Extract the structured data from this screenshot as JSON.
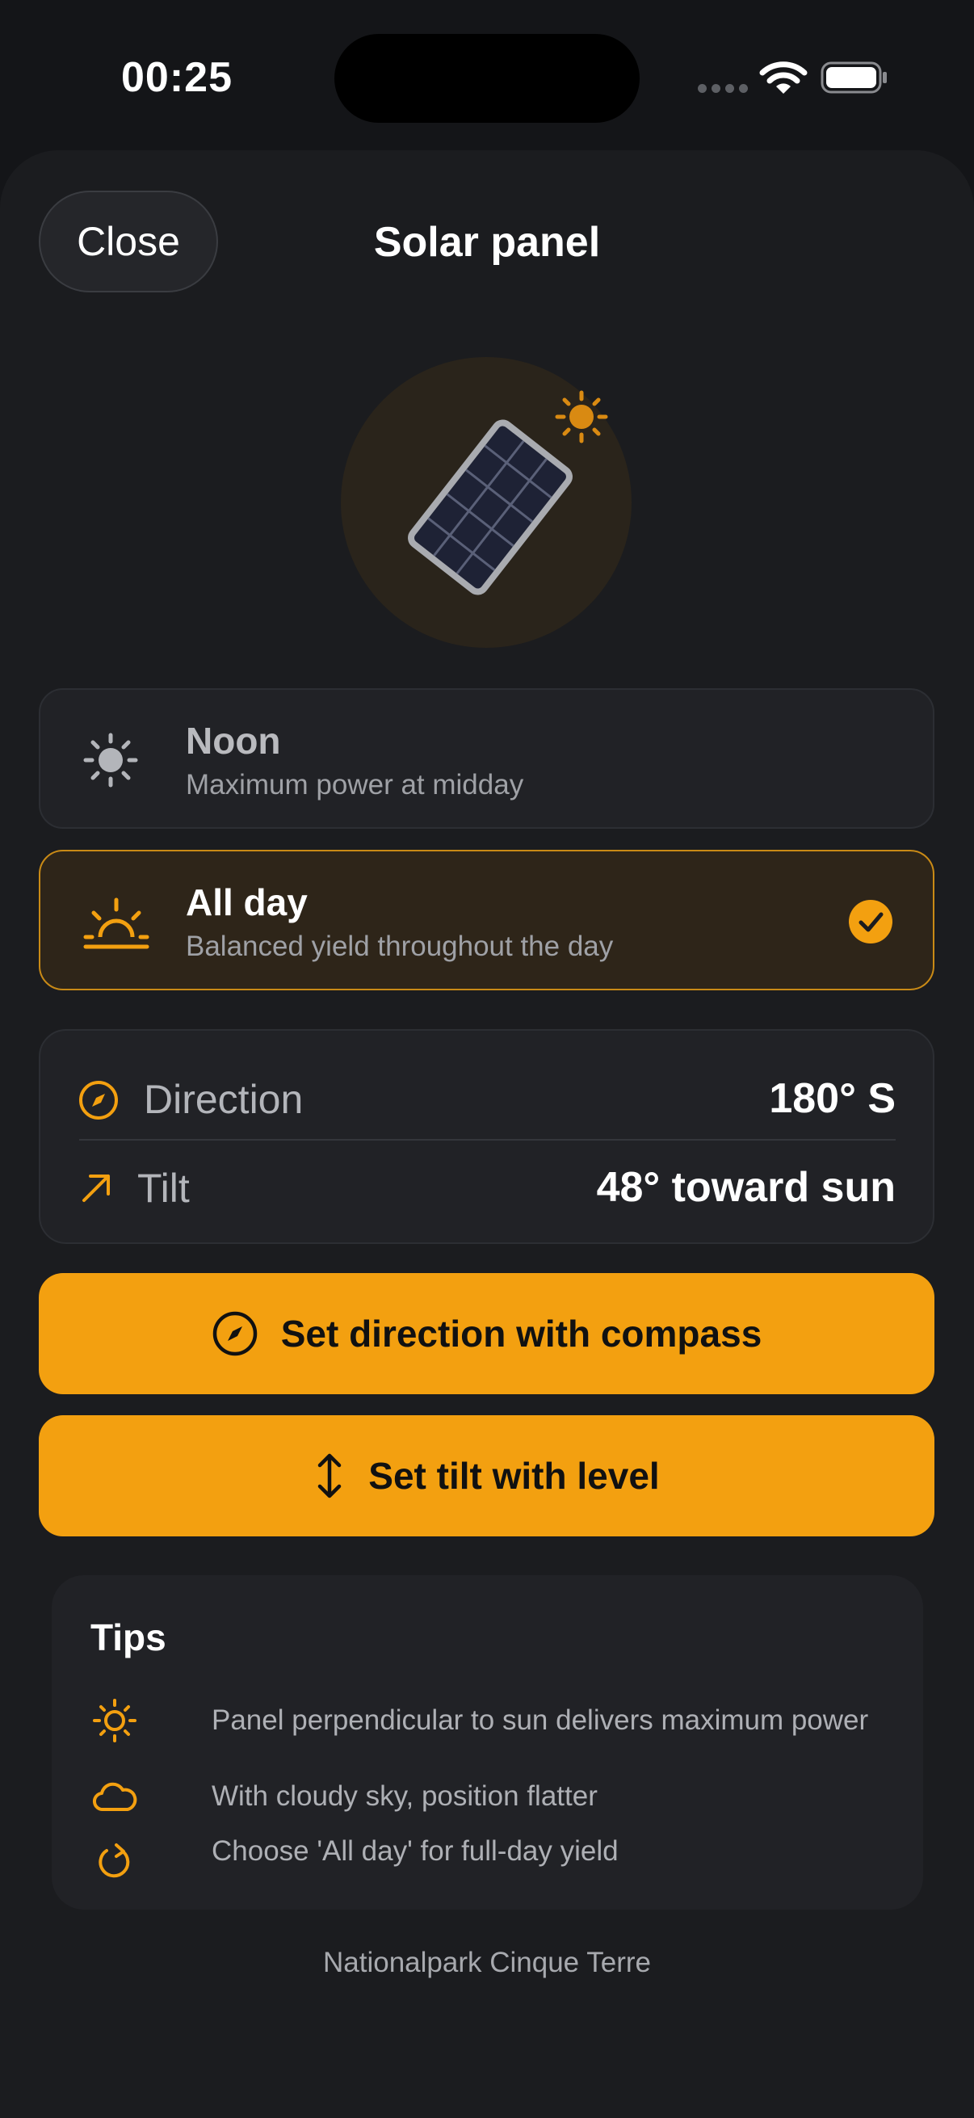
{
  "status_bar": {
    "time": "00:25",
    "battery_icon": "battery-full-icon",
    "wifi_icon": "wifi-icon"
  },
  "header": {
    "close_label": "Close",
    "title": "Solar panel"
  },
  "hero": {
    "icon": "solar-panel-icon",
    "badge_icon": "sun-icon"
  },
  "modes": [
    {
      "title": "Noon",
      "subtitle": "Maximum power at midday",
      "icon": "sun-icon",
      "selected": false
    },
    {
      "title": "All day",
      "subtitle": "Balanced yield throughout the day",
      "icon": "sunrise-icon",
      "selected": true
    }
  ],
  "info": {
    "direction_label": "Direction",
    "direction_value": "180° S",
    "tilt_label": "Tilt",
    "tilt_value": "48° toward sun"
  },
  "actions": {
    "compass_label": "Set direction with compass",
    "level_label": "Set tilt with level"
  },
  "tips": {
    "title": "Tips",
    "items": [
      {
        "icon": "sun-icon",
        "text": "Panel perpendicular to sun delivers maximum power"
      },
      {
        "icon": "cloud-icon",
        "text": "With cloudy sky, position flatter"
      },
      {
        "icon": "refresh-icon",
        "text": "Choose 'All day' for full-day yield"
      }
    ]
  },
  "footer": {
    "location": "Nationalpark Cinque Terre"
  },
  "colors": {
    "accent": "#f3a010",
    "background": "#141518",
    "card": "#212226",
    "selected_card": "#2e2519"
  }
}
